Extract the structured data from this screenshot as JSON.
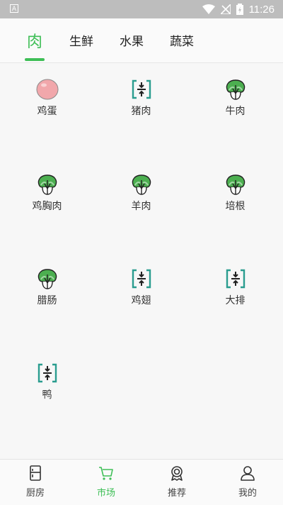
{
  "status_bar": {
    "time": "11:26",
    "app_badge": "A"
  },
  "tabs": [
    {
      "label": "肉",
      "active": true
    },
    {
      "label": "生鲜",
      "active": false
    },
    {
      "label": "水果",
      "active": false
    },
    {
      "label": "蔬菜",
      "active": false
    }
  ],
  "items": [
    {
      "label": "鸡蛋",
      "icon": "egg-icon"
    },
    {
      "label": "猪肉",
      "icon": "compress-icon"
    },
    {
      "label": "牛肉",
      "icon": "cabbage-icon"
    },
    {
      "label": "鸡胸肉",
      "icon": "cabbage-icon"
    },
    {
      "label": "羊肉",
      "icon": "cabbage-icon"
    },
    {
      "label": "培根",
      "icon": "cabbage-icon"
    },
    {
      "label": "腊肠",
      "icon": "cabbage-icon"
    },
    {
      "label": "鸡翅",
      "icon": "compress-icon"
    },
    {
      "label": "大排",
      "icon": "compress-icon"
    },
    {
      "label": "鸭",
      "icon": "compress-icon"
    }
  ],
  "bottom_nav": [
    {
      "label": "厨房",
      "icon": "fridge-icon",
      "active": false
    },
    {
      "label": "市场",
      "icon": "cart-icon",
      "active": true
    },
    {
      "label": "推荐",
      "icon": "award-icon",
      "active": false
    },
    {
      "label": "我的",
      "icon": "user-icon",
      "active": false
    }
  ],
  "colors": {
    "accent": "#3fbf57",
    "icon_teal": "#2a9d8f",
    "cabbage_green": "#4caf50",
    "egg_pink": "#f1a7ab"
  }
}
